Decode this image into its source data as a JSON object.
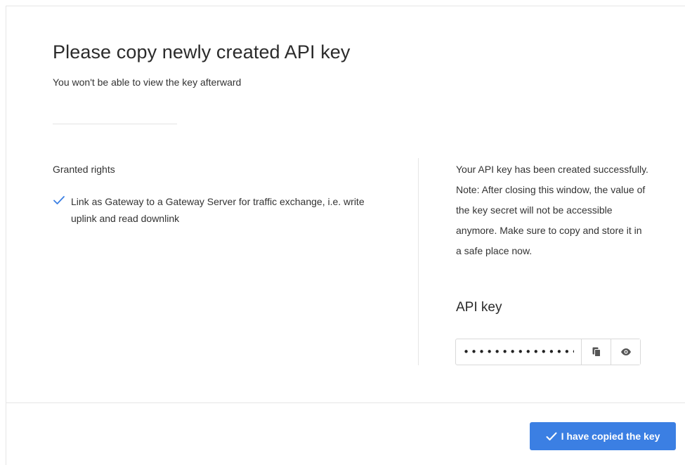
{
  "modal": {
    "title": "Please copy newly created API key",
    "subtitle": "You won't be able to view the key afterward"
  },
  "rights": {
    "heading": "Granted rights",
    "items": [
      {
        "text": "Link as Gateway to a Gateway Server for traffic exchange, i.e. write uplink and read downlink",
        "icon": "check-icon"
      }
    ]
  },
  "notice": {
    "text": "Your API key has been created successfully. Note: After closing this window, the value of the key secret will not be accessible anymore. Make sure to copy and store it in a safe place now."
  },
  "api_key": {
    "heading": "API key",
    "masked_value": "••••••••••••••••",
    "copy_icon": "copy-icon",
    "show_icon": "eye-icon"
  },
  "footer": {
    "confirm_label": "I have copied the key",
    "confirm_icon": "check-icon"
  },
  "colors": {
    "primary": "#3b7fe3",
    "check": "#3b7fe3",
    "border": "#d9d9d9"
  }
}
